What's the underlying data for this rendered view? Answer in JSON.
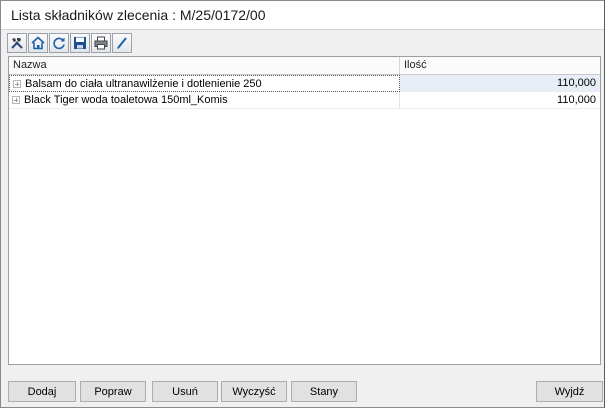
{
  "window": {
    "title": "Lista składników zlecenia : M/25/0172/00"
  },
  "toolbar": {
    "buttons": [
      {
        "icon": "tools-icon"
      },
      {
        "icon": "home-icon"
      },
      {
        "icon": "refresh-icon"
      },
      {
        "icon": "save-icon"
      },
      {
        "icon": "print-icon"
      },
      {
        "icon": "pen-icon"
      }
    ]
  },
  "grid": {
    "columns": [
      "Nazwa",
      "Ilość"
    ],
    "rows": [
      {
        "name": "Balsam do ciała ultranawilżenie i dotlenienie 250",
        "qty": "110,000"
      },
      {
        "name": "Black Tiger woda toaletowa 150ml_Komis",
        "qty": "110,000"
      }
    ]
  },
  "buttons": {
    "add": "Dodaj",
    "edit": "Popraw",
    "delete": "Usuń",
    "clear": "Wyczyść",
    "stock": "Stany",
    "exit": "Wyjdź"
  }
}
